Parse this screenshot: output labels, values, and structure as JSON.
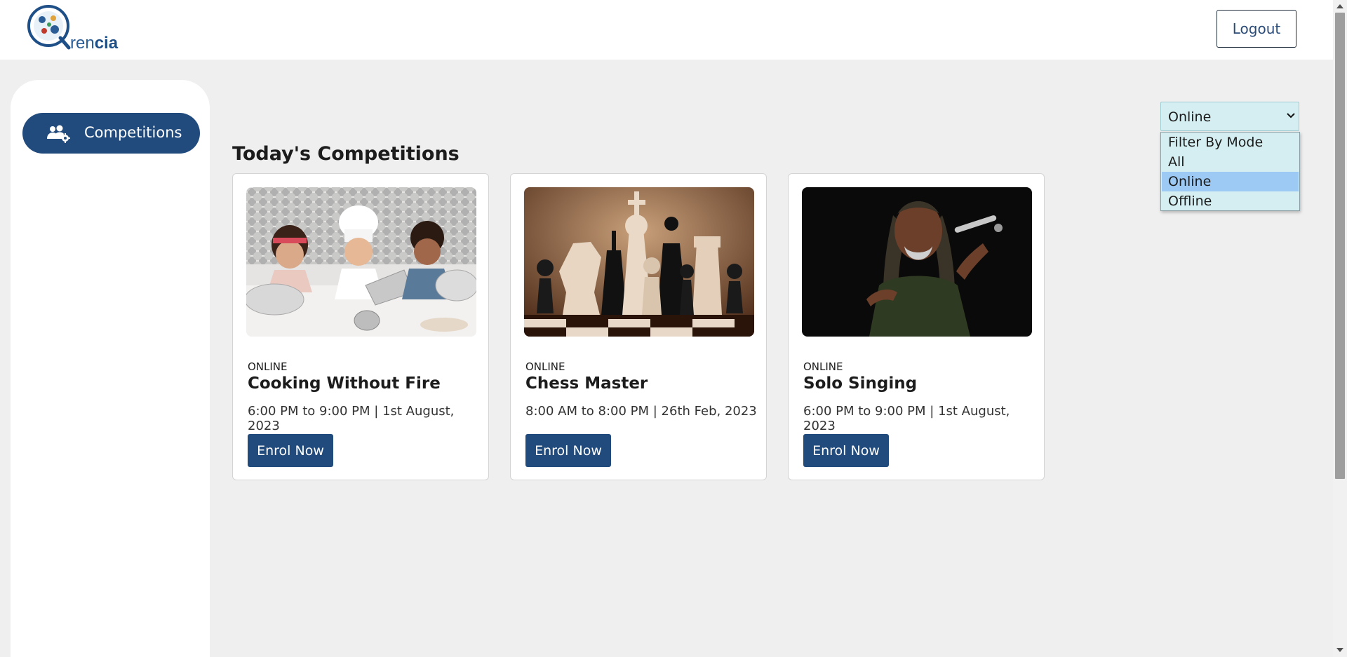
{
  "header": {
    "logo_text_regular": "ren",
    "logo_text_bold": "cia",
    "logout_label": "Logout"
  },
  "sidebar": {
    "items": [
      {
        "label": "Competitions",
        "icon": "users-gear-icon"
      }
    ]
  },
  "main": {
    "title": "Today's Competitions",
    "filter": {
      "selected": "Online",
      "options": [
        "Filter By Mode",
        "All",
        "Online",
        "Offline"
      ],
      "highlighted_index": 2
    },
    "cards": [
      {
        "mode": "ONLINE",
        "title": "Cooking Without Fire",
        "time": "6:00 PM to 9:00 PM | 1st August, 2023",
        "button": "Enrol Now",
        "image": "kids-cooking-photo"
      },
      {
        "mode": "ONLINE",
        "title": "Chess Master",
        "time": "8:00 AM to 8:00 PM | 26th Feb, 2023",
        "button": "Enrol Now",
        "image": "chess-pieces-photo"
      },
      {
        "mode": "ONLINE",
        "title": "Solo Singing",
        "time": "6:00 PM to 9:00 PM | 1st August, 2023",
        "button": "Enrol Now",
        "image": "singer-photo"
      }
    ]
  },
  "colors": {
    "primary": "#224b7d",
    "background": "#efefef",
    "select_bg": "#d5eef1",
    "option_highlight": "#9ccaf5"
  }
}
